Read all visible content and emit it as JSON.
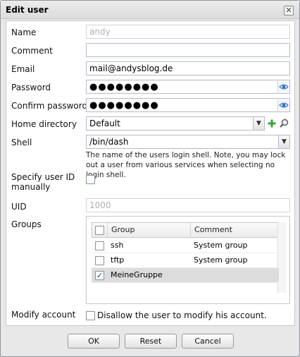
{
  "dialog": {
    "title": "Edit user"
  },
  "form": {
    "name": {
      "label": "Name",
      "value": "andy"
    },
    "comment": {
      "label": "Comment",
      "value": ""
    },
    "email": {
      "label": "Email",
      "value": "mail@andysblog.de"
    },
    "password": {
      "label": "Password",
      "value": "●●●●●●●●"
    },
    "confirm_password": {
      "label": "Confirm password",
      "value": "●●●●●●●●"
    },
    "home_directory": {
      "label": "Home directory",
      "value": "Default"
    },
    "shell": {
      "label": "Shell",
      "value": "/bin/dash",
      "hint": "The name of the users login shell. Note, you may lock out a user from various services when selecting no login shell."
    },
    "specify_uid": {
      "label": "Specify user ID manually",
      "checked": false
    },
    "uid": {
      "label": "UID",
      "value": "1000"
    },
    "groups": {
      "label": "Groups",
      "columns": [
        "Group",
        "Comment"
      ],
      "rows": [
        {
          "group": "ssh",
          "comment": "System group",
          "checked": false
        },
        {
          "group": "tftp",
          "comment": "System group",
          "checked": false
        },
        {
          "group": "MeineGruppe",
          "comment": "",
          "checked": true
        }
      ]
    },
    "modify_account": {
      "label": "Modify account",
      "option_label": "Disallow the user to modify his account.",
      "checked": false
    }
  },
  "buttons": {
    "ok": "OK",
    "reset": "Reset",
    "cancel": "Cancel"
  },
  "icons": {
    "close": "close-icon",
    "eye": "eye-icon",
    "add": "add-icon",
    "search": "search-icon",
    "chevron": "chevron-down-icon"
  },
  "colors": {
    "accent": "#2b6fb5",
    "add_green": "#3aa23a",
    "checkmark": "#1a3d8a"
  }
}
